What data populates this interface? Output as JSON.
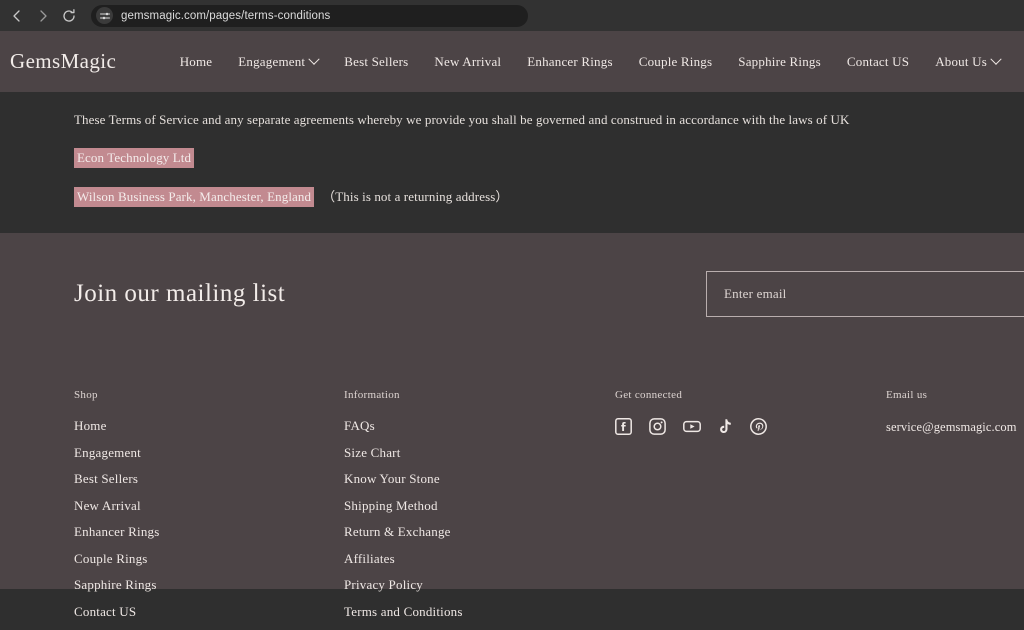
{
  "browser": {
    "back_icon": "back-arrow-icon",
    "forward_icon": "forward-arrow-icon",
    "reload_icon": "reload-icon",
    "site_info_icon": "site-settings-icon",
    "url": "gemsmagic.com/pages/terms-conditions"
  },
  "header": {
    "logo": "GemsMagic",
    "nav": [
      {
        "label": "Home",
        "dropdown": false
      },
      {
        "label": "Engagement",
        "dropdown": true
      },
      {
        "label": "Best Sellers",
        "dropdown": false
      },
      {
        "label": "New Arrival",
        "dropdown": false
      },
      {
        "label": "Enhancer Rings",
        "dropdown": false
      },
      {
        "label": "Couple Rings",
        "dropdown": false
      },
      {
        "label": "Sapphire Rings",
        "dropdown": false
      },
      {
        "label": "Contact US",
        "dropdown": false
      },
      {
        "label": "About Us",
        "dropdown": true
      }
    ]
  },
  "content": {
    "terms_paragraph": "These Terms of Service and any separate agreements whereby we provide you shall be governed and construed in accordance with the laws of UK",
    "company_name": "Econ Technology Ltd",
    "company_address": "Wilson Business Park, Manchester, England",
    "address_note": "（This is not a returning address）",
    "highlight_color": "#c28a90"
  },
  "newsletter": {
    "title": "Join our mailing list",
    "placeholder": "Enter email",
    "value": ""
  },
  "footer": {
    "columns": [
      {
        "title": "Shop",
        "links": [
          "Home",
          "Engagement",
          "Best Sellers",
          "New Arrival",
          "Enhancer Rings",
          "Couple Rings",
          "Sapphire Rings",
          "Contact US"
        ]
      },
      {
        "title": "Information",
        "links": [
          "FAQs",
          "Size Chart",
          "Know Your Stone",
          "Shipping Method",
          "Return & Exchange",
          "Affiliates",
          "Privacy Policy",
          "Terms and Conditions"
        ]
      }
    ],
    "social": {
      "title": "Get connected",
      "icons": [
        "facebook-icon",
        "instagram-icon",
        "youtube-icon",
        "tiktok-icon",
        "pinterest-icon"
      ]
    },
    "email": {
      "title": "Email us",
      "address": "service@gemsmagic.com"
    }
  }
}
